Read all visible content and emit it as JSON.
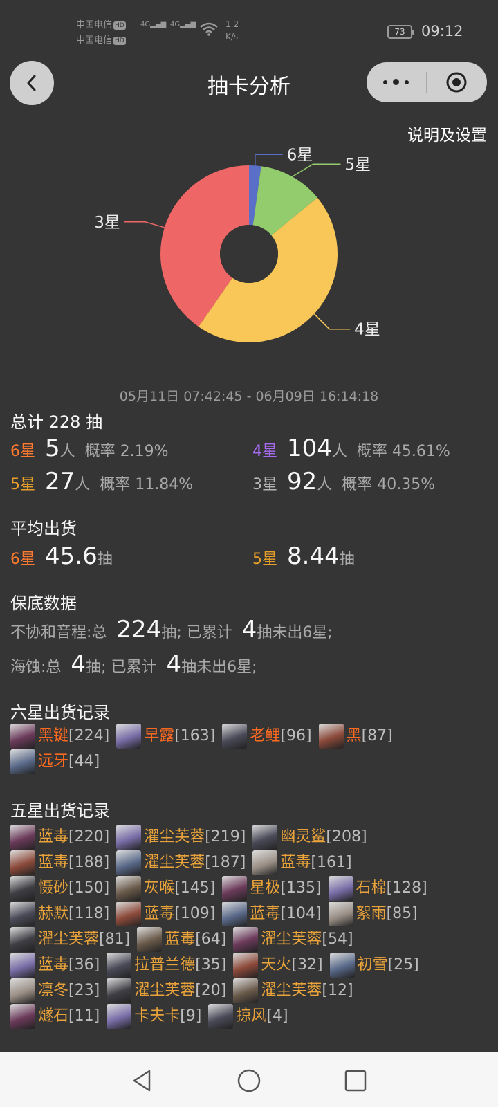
{
  "status": {
    "carrier1": "中国电信",
    "carrier2": "中国电信",
    "hd": "HD",
    "net": "4G",
    "speed_val": "1.2",
    "speed_unit": "K/s",
    "battery": "73",
    "time": "09:12"
  },
  "header": {
    "title": "抽卡分析",
    "settings": "说明及设置"
  },
  "chart_data": {
    "type": "pie",
    "style": "donut",
    "slices": [
      {
        "label": "6星",
        "value": 5,
        "color": "#5a6fc8"
      },
      {
        "label": "5星",
        "value": 27,
        "color": "#92cc6c"
      },
      {
        "label": "4星",
        "value": 104,
        "color": "#f9c757"
      },
      {
        "label": "3星",
        "value": 92,
        "color": "#ee6666"
      }
    ]
  },
  "range": "05月11日 07:42:45 - 06月09日 16:14:18",
  "total": {
    "label": "总计 228 抽"
  },
  "stats": [
    {
      "star": "6星",
      "count": "5",
      "unit": "人",
      "rate": "概率 2.19%"
    },
    {
      "star": "4星",
      "count": "104",
      "unit": "人",
      "rate": "概率 45.61%"
    },
    {
      "star": "5星",
      "count": "27",
      "unit": "人",
      "rate": "概率 11.84%"
    },
    {
      "star": "3星",
      "count": "92",
      "unit": "人",
      "rate": "概率 40.35%"
    }
  ],
  "avg": {
    "title": "平均出货",
    "six_star": "6星",
    "six_val": "45.6",
    "unit": "抽",
    "five_star": "5星",
    "five_val": "8.44"
  },
  "pity": {
    "title": "保底数据",
    "l1_name": "不协和音程:总",
    "l1_total": "224",
    "l1_mid": "抽; 已累计",
    "l1_cur": "4",
    "l1_tail": "抽未出6星;",
    "l2_name": "海蚀:总",
    "l2_total": "4",
    "l2_mid": "抽; 已累计",
    "l2_cur": "4",
    "l2_tail": "抽未出6星;"
  },
  "six_title": "六星出货记录",
  "six_records": [
    {
      "name": "黑键",
      "pull": "[224]"
    },
    {
      "name": "早露",
      "pull": "[163]"
    },
    {
      "name": "老鲤",
      "pull": "[96]"
    },
    {
      "name": "黑",
      "pull": "[87]"
    },
    {
      "name": "远牙",
      "pull": "[44]"
    }
  ],
  "five_title": "五星出货记录",
  "five_records": [
    {
      "name": "蓝毒",
      "pull": "[220]"
    },
    {
      "name": "濯尘芙蓉",
      "pull": "[219]"
    },
    {
      "name": "幽灵鲨",
      "pull": "[208]"
    },
    {
      "name": "蓝毒",
      "pull": "[188]"
    },
    {
      "name": "濯尘芙蓉",
      "pull": "[187]"
    },
    {
      "name": "蓝毒",
      "pull": "[161]"
    },
    {
      "name": "慑砂",
      "pull": "[150]"
    },
    {
      "name": "灰喉",
      "pull": "[145]"
    },
    {
      "name": "星极",
      "pull": "[135]"
    },
    {
      "name": "石棉",
      "pull": "[128]"
    },
    {
      "name": "赫默",
      "pull": "[118]"
    },
    {
      "name": "蓝毒",
      "pull": "[109]"
    },
    {
      "name": "蓝毒",
      "pull": "[104]"
    },
    {
      "name": "絮雨",
      "pull": "[85]"
    },
    {
      "name": "濯尘芙蓉",
      "pull": "[81]"
    },
    {
      "name": "蓝毒",
      "pull": "[64]"
    },
    {
      "name": "濯尘芙蓉",
      "pull": "[54]"
    },
    {
      "name": "蓝毒",
      "pull": "[36]"
    },
    {
      "name": "拉普兰德",
      "pull": "[35]"
    },
    {
      "name": "天火",
      "pull": "[32]"
    },
    {
      "name": "初雪",
      "pull": "[25]"
    },
    {
      "name": "凛冬",
      "pull": "[23]"
    },
    {
      "name": "濯尘芙蓉",
      "pull": "[20]"
    },
    {
      "name": "濯尘芙蓉",
      "pull": "[12]"
    },
    {
      "name": "燧石",
      "pull": "[11]"
    },
    {
      "name": "卡夫卡",
      "pull": "[9]"
    },
    {
      "name": "掠风",
      "pull": "[4]"
    }
  ]
}
